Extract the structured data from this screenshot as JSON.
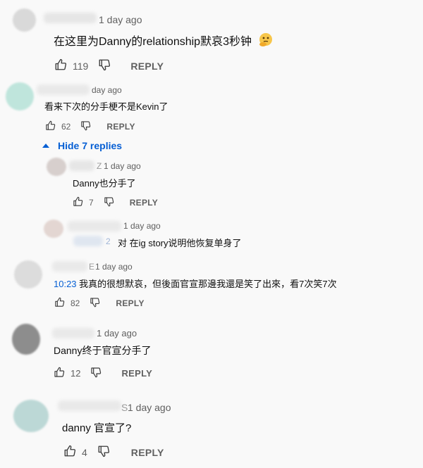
{
  "comments": [
    {
      "time": "1 day ago",
      "text": "在这里为Danny的relationship默哀3秒钟",
      "likes": "119",
      "reply_label": "REPLY",
      "emoji": "thinking-face-emoji"
    },
    {
      "time": "day ago",
      "text": "看来下次的分手梗不是Kevin了",
      "likes": "62",
      "reply_label": "REPLY"
    },
    {
      "time": "1 day ago",
      "text": "Danny也分手了",
      "likes": "7",
      "reply_label": "REPLY",
      "name_fragment": "Z"
    },
    {
      "time": "1 day ago",
      "text": "对 在ig story说明他恢复单身了",
      "mention_fragment": "2"
    },
    {
      "time": "1 day ago",
      "timestamp_link": "10:23",
      "text": "我真的很想默哀，但後面官宣那邊我還是笑了出來，看7次笑7次",
      "likes": "82",
      "reply_label": "REPLY",
      "name_fragment": "E"
    },
    {
      "time": "1 day ago",
      "text": "Danny终于官宣分手了",
      "likes": "12",
      "reply_label": "REPLY"
    },
    {
      "time": "1 day ago",
      "text": "danny 官宣了?",
      "likes": "4",
      "reply_label": "REPLY",
      "name_fragment": "S"
    }
  ],
  "hide_replies_label": "Hide 7 replies",
  "colors": {
    "link_blue": "#065fd4",
    "muted_text": "#606060",
    "background": "#f9f9f9"
  },
  "icons": [
    "like-icon",
    "dislike-icon",
    "caret-up-icon",
    "thinking-face-emoji"
  ]
}
